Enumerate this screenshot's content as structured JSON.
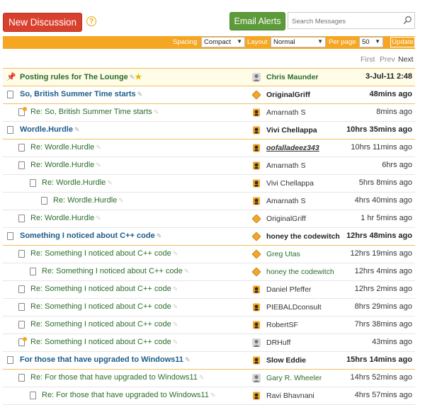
{
  "toolbar": {
    "new_discussion": "New Discussion",
    "help_glyph": "?",
    "email_alerts": "Email Alerts",
    "search_placeholder": "Search Messages"
  },
  "options_bar": {
    "spacing_label": "Spacing",
    "spacing_value": "Compact",
    "layout_label": "Layout",
    "layout_value": "Normal",
    "per_page_label": "Per page",
    "per_page_value": "50",
    "update_label": "Update"
  },
  "pager": {
    "first": "First",
    "prev": "Prev",
    "next": "Next"
  },
  "colors": {
    "accent": "#f5a623",
    "new_button": "#d9412f",
    "email_button": "#5c9a3a",
    "root_subject": "#1d5c8a",
    "reply_subject": "#2a6d2a"
  },
  "messages": [
    {
      "subject": "Posting rules for The Lounge",
      "author": "Chris Maunder",
      "date": "3-Jul-11 2:48",
      "depth": 0,
      "kind": "pinned",
      "avatar": "user-icon"
    },
    {
      "subject": "So, British Summer Time starts",
      "author": "OriginalGriff",
      "date": "48mins ago",
      "depth": 0,
      "kind": "root",
      "avatar": "diamond-icon"
    },
    {
      "subject": "Re: So, British Summer Time starts",
      "author": "Amarnath S",
      "date": "8mins ago",
      "depth": 1,
      "kind": "reply-new",
      "avatar": "badge-icon"
    },
    {
      "subject": "Wordle.Hurdle",
      "author": "Vivi Chellappa",
      "date": "10hrs 35mins ago",
      "depth": 0,
      "kind": "root",
      "avatar": "badge-icon"
    },
    {
      "subject": "Re: Wordle.Hurdle",
      "author": "oofalladeez343",
      "date": "10hrs 11mins ago",
      "depth": 1,
      "kind": "reply",
      "avatar": "badge-icon"
    },
    {
      "subject": "Re: Wordle.Hurdle",
      "author": "Amarnath S",
      "date": "6hrs ago",
      "depth": 1,
      "kind": "reply",
      "avatar": "badge-icon"
    },
    {
      "subject": "Re: Wordle.Hurdle",
      "author": "Vivi Chellappa",
      "date": "5hrs 8mins ago",
      "depth": 2,
      "kind": "reply",
      "avatar": "badge-icon"
    },
    {
      "subject": "Re: Wordle.Hurdle",
      "author": "Amarnath S",
      "date": "4hrs 40mins ago",
      "depth": 3,
      "kind": "reply",
      "avatar": "badge-icon"
    },
    {
      "subject": "Re: Wordle.Hurdle",
      "author": "OriginalGriff",
      "date": "1 hr 5mins ago",
      "depth": 1,
      "kind": "reply",
      "avatar": "diamond-icon"
    },
    {
      "subject": "Something I noticed about C++ code",
      "author": "honey the codewitch",
      "date": "12hrs 48mins ago",
      "depth": 0,
      "kind": "root",
      "avatar": "diamond-icon"
    },
    {
      "subject": "Re: Something I noticed about C++ code",
      "author": "Greg Utas",
      "date": "12hrs 19mins ago",
      "depth": 1,
      "kind": "reply",
      "avatar": "diamond-icon"
    },
    {
      "subject": "Re: Something I noticed about C++ code",
      "author": "honey the codewitch",
      "date": "12hrs 4mins ago",
      "depth": 2,
      "kind": "reply",
      "avatar": "diamond-icon"
    },
    {
      "subject": "Re: Something I noticed about C++ code",
      "author": "Daniel Pfeffer",
      "date": "12hrs 2mins ago",
      "depth": 1,
      "kind": "reply",
      "avatar": "badge-icon"
    },
    {
      "subject": "Re: Something I noticed about C++ code",
      "author": "PIEBALDconsult",
      "date": "8hrs 29mins ago",
      "depth": 1,
      "kind": "reply",
      "avatar": "badge-icon"
    },
    {
      "subject": "Re: Something I noticed about C++ code",
      "author": "RobertSF",
      "date": "7hrs 38mins ago",
      "depth": 1,
      "kind": "reply",
      "avatar": "badge-icon"
    },
    {
      "subject": "Re: Something I noticed about C++ code",
      "author": "DRHuff",
      "date": "43mins ago",
      "depth": 1,
      "kind": "reply-new",
      "avatar": "user-icon"
    },
    {
      "subject": "For those that have upgraded to Windows11",
      "author": "Slow Eddie",
      "date": "15hrs 14mins ago",
      "depth": 0,
      "kind": "root",
      "avatar": "badge-icon"
    },
    {
      "subject": "Re: For those that have upgraded to Windows11",
      "author": "Gary R. Wheeler",
      "date": "14hrs 52mins ago",
      "depth": 1,
      "kind": "reply",
      "avatar": "user-icon"
    },
    {
      "subject": "Re: For those that have upgraded to Windows11",
      "author": "Ravi Bhavnani",
      "date": "4hrs 57mins ago",
      "depth": 2,
      "kind": "reply",
      "avatar": "badge-icon"
    }
  ]
}
